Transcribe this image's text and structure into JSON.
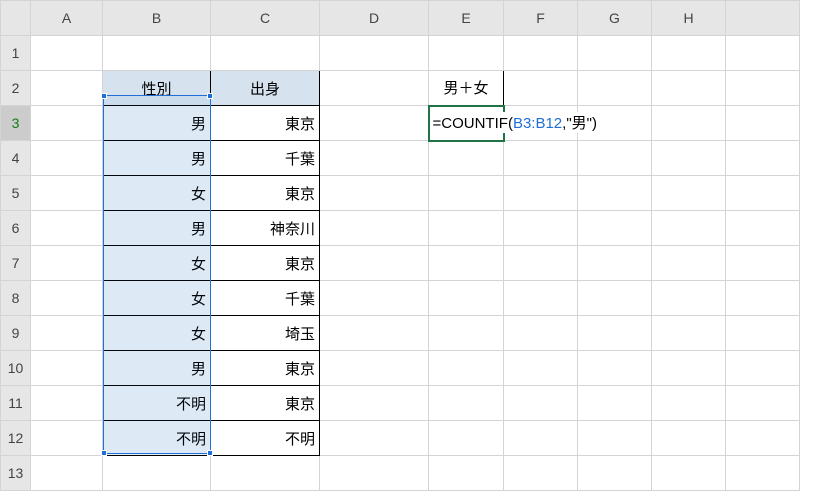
{
  "columns": [
    "A",
    "B",
    "C",
    "D",
    "E",
    "F",
    "G",
    "H"
  ],
  "rows": [
    "1",
    "2",
    "3",
    "4",
    "5",
    "6",
    "7",
    "8",
    "9",
    "10",
    "11",
    "12",
    "13"
  ],
  "active_row": "3",
  "headers": {
    "B2": "性別",
    "C2": "出身"
  },
  "data_b": [
    "男",
    "男",
    "女",
    "男",
    "女",
    "女",
    "女",
    "男",
    "不明",
    "不明"
  ],
  "data_c": [
    "東京",
    "千葉",
    "東京",
    "神奈川",
    "東京",
    "千葉",
    "埼玉",
    "東京",
    "東京",
    "不明"
  ],
  "e2": "男＋女",
  "formula": {
    "eq": "=",
    "name": "COUNTIF",
    "open": "(",
    "ref": "B3:B12",
    "comma": ",",
    "str": "\"男\"",
    "close": ")"
  },
  "selected_range": "B3:B12",
  "chart_data": {
    "type": "table",
    "title": "",
    "columns": [
      "性別",
      "出身"
    ],
    "rows": [
      [
        "男",
        "東京"
      ],
      [
        "男",
        "千葉"
      ],
      [
        "女",
        "東京"
      ],
      [
        "男",
        "神奈川"
      ],
      [
        "女",
        "東京"
      ],
      [
        "女",
        "千葉"
      ],
      [
        "女",
        "埼玉"
      ],
      [
        "男",
        "東京"
      ],
      [
        "不明",
        "東京"
      ],
      [
        "不明",
        "不明"
      ]
    ]
  }
}
